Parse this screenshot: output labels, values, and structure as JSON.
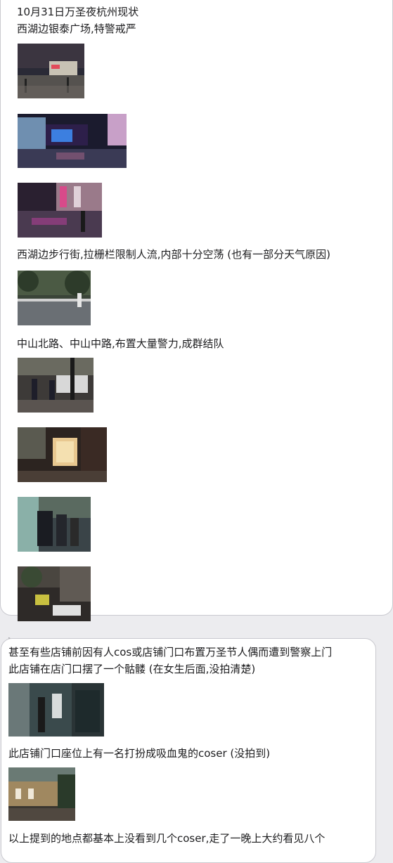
{
  "post": {
    "line1": "10月31日万圣夜杭州现状",
    "line2": "西湖边银泰广场,特警戒严",
    "line3": "西湖边步行街,拉栅栏限制人流,内部十分空荡 (也有一部分天气原因)",
    "line4": "中山北路、中山中路,布置大量警力,成群结队"
  },
  "reply": {
    "line1": "甚至有些店铺前因有人cos或店铺门口布置万圣节人偶而遭到警察上门",
    "line2": "此店铺在店门口摆了一个骷髅 (在女生后面,没拍清楚)",
    "line3": "此店铺门口座位上有一名打扮成吸血鬼的coser (没拍到)",
    "line4": "以上提到的地点都基本上没看到几个coser,走了一晚上大约看见八个"
  }
}
